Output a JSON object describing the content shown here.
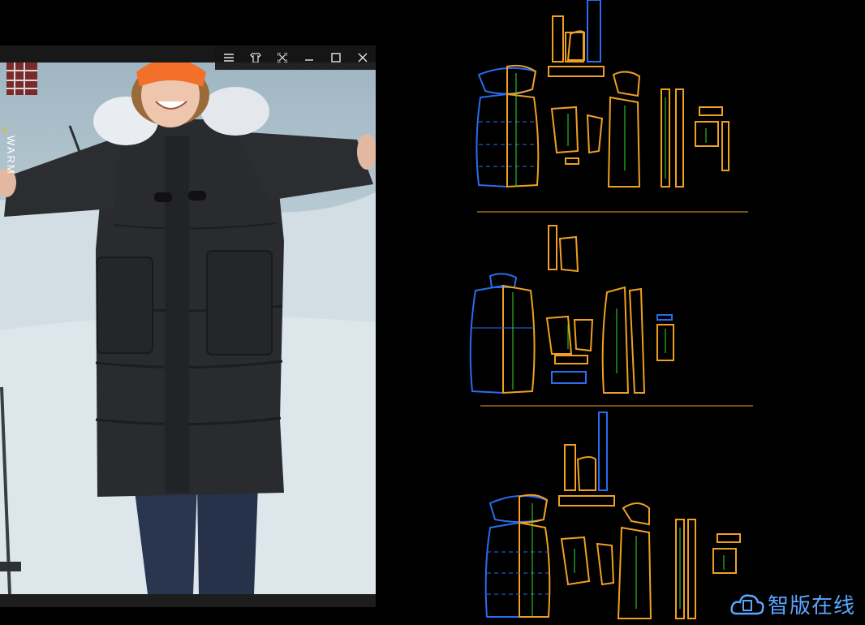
{
  "viewer": {
    "controls": [
      {
        "icon": "menu-icon",
        "glyph": "☰"
      },
      {
        "icon": "shirt-icon",
        "glyph": "👕"
      },
      {
        "icon": "fullscreen-icon",
        "glyph": "⛶"
      },
      {
        "icon": "minimize-icon",
        "glyph": "—"
      },
      {
        "icon": "maximize-icon",
        "glyph": "☐"
      },
      {
        "icon": "close-icon",
        "glyph": "✕"
      }
    ],
    "brand_text": "WARM",
    "brand_accent": "Y"
  },
  "colors": {
    "pattern_orange": "#f0a020",
    "pattern_blue": "#2a6cf0",
    "annotation_green": "#30e030",
    "accent_yellow": "#f0b400",
    "watermark_blue": "#5aa6ff"
  },
  "watermark": {
    "text": "智版在线",
    "icon": "cloud-logo-icon"
  }
}
